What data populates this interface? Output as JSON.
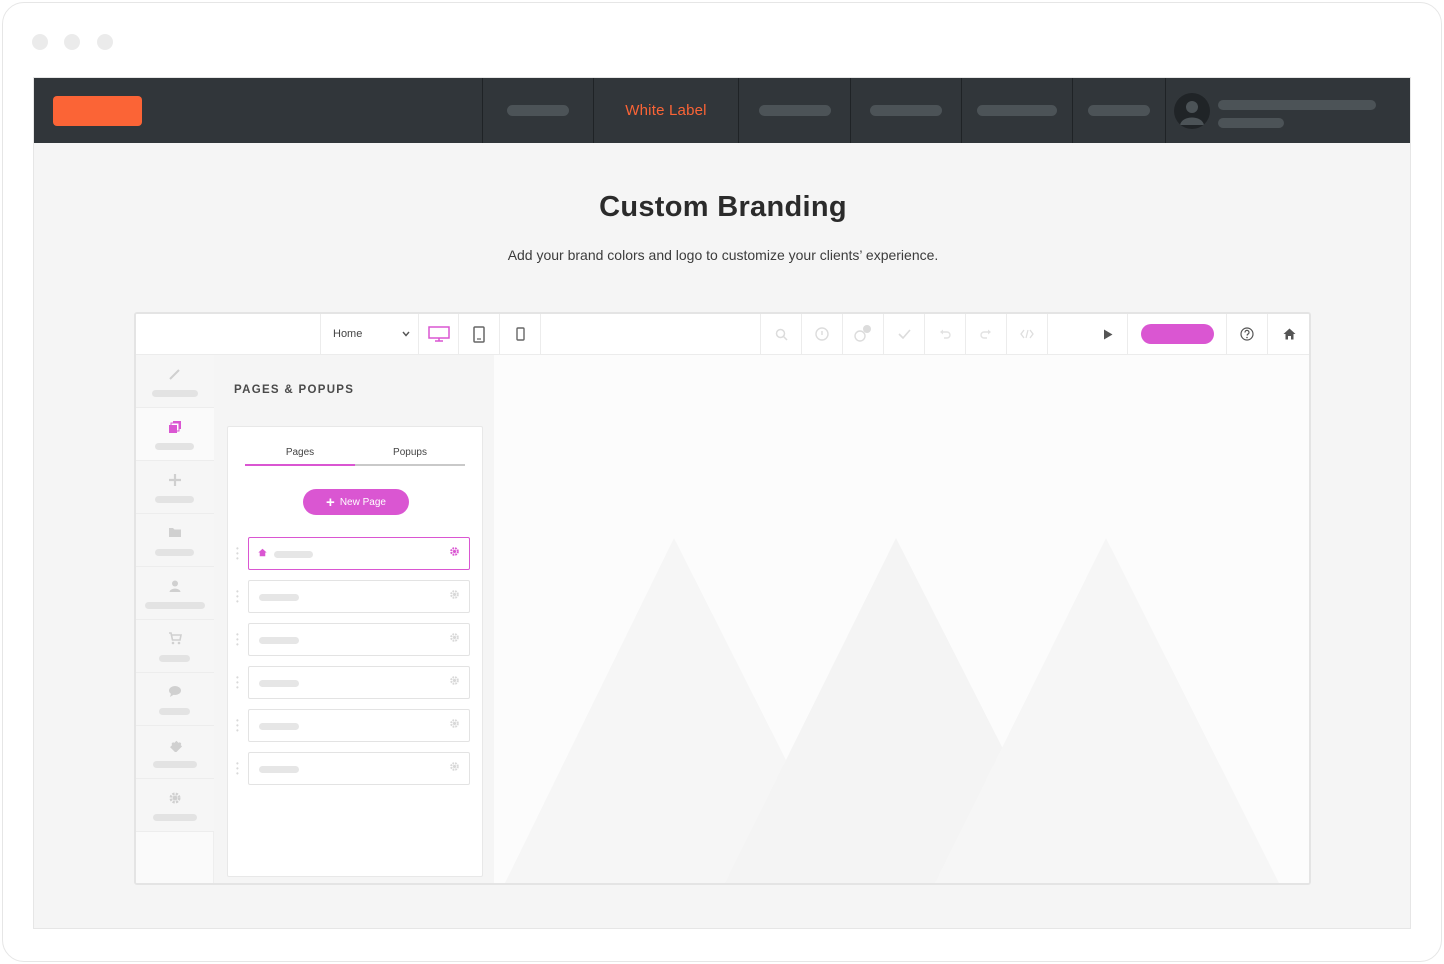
{
  "colors": {
    "accent": "#fb6436",
    "magenta": "#da56d2"
  },
  "window": {
    "controls": [
      "close-dot",
      "minimize-dot",
      "maximize-dot"
    ]
  },
  "nav": {
    "white_label": "White Label"
  },
  "header": {
    "title": "Custom Branding",
    "subtitle": "Add your brand colors and logo to customize your clients’ experience."
  },
  "editor": {
    "page_select": {
      "value": "Home"
    },
    "toolbar_icons": [
      "desktop-icon",
      "tablet-icon",
      "mobile-icon",
      "search-icon",
      "history-icon",
      "notification-icon",
      "check-icon",
      "undo-icon",
      "redo-icon",
      "code-icon",
      "play-icon",
      "help-icon",
      "home-icon"
    ],
    "sidebar_icons": [
      "brush-icon",
      "pages-icon",
      "add-icon",
      "folder-icon",
      "user-icon",
      "cart-icon",
      "chat-icon",
      "puzzle-icon",
      "gear-icon"
    ],
    "panel": {
      "title": "PAGES & POPUPS",
      "tabs": [
        "Pages",
        "Popups"
      ],
      "active_tab": "Pages",
      "new_page": "New Page"
    }
  }
}
